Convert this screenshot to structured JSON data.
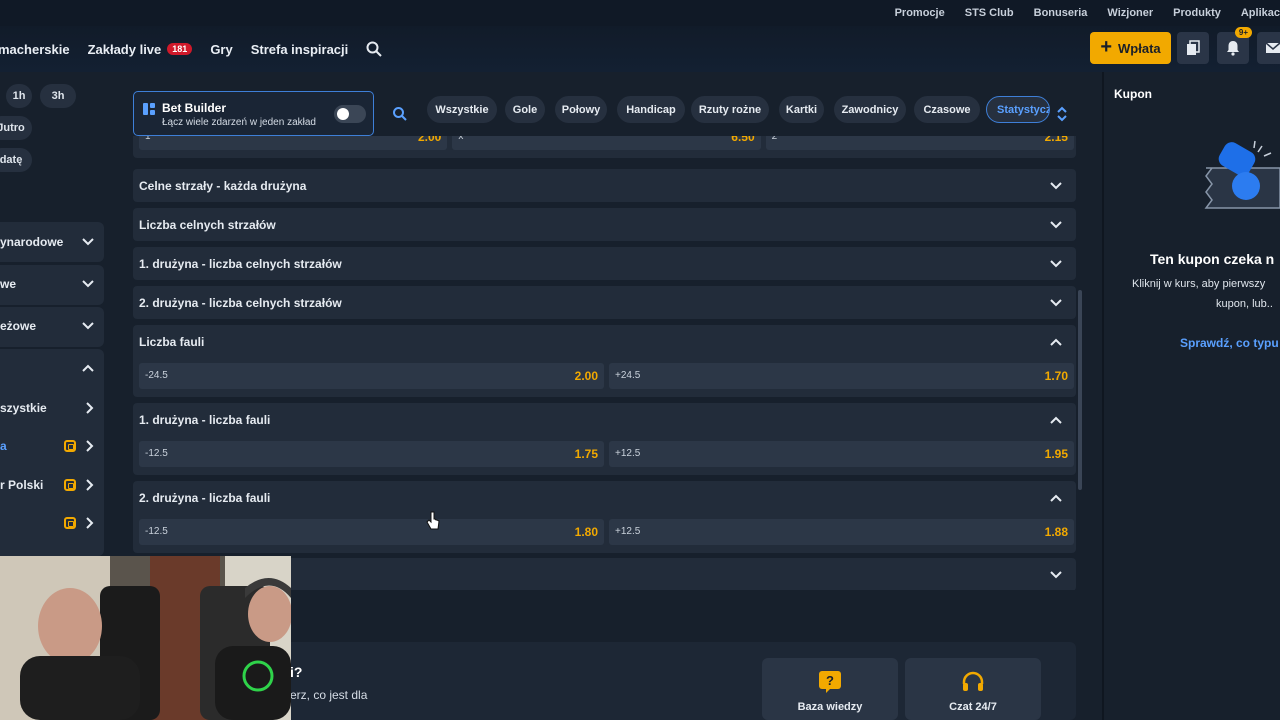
{
  "top_links": [
    "Promocje",
    "STS Club",
    "Bonuseria",
    "Wizjoner",
    "Produkty",
    "Aplikac"
  ],
  "nav": {
    "items": [
      {
        "label": "macherskie"
      },
      {
        "label": "Zakłady live",
        "badge": "181"
      },
      {
        "label": "Gry"
      },
      {
        "label": "Strefa inspiracji"
      }
    ],
    "deposit_label": "Wpłata",
    "notif_badge": "9+"
  },
  "sidebar": {
    "time_chips": [
      "1h",
      "3h"
    ],
    "day_chips": [
      "Jutro",
      "datę"
    ],
    "categories": [
      {
        "label": "ynarodowe",
        "chevron": "down"
      },
      {
        "label": "we",
        "chevron": "down"
      },
      {
        "label": "eżowe",
        "chevron": "down"
      },
      {
        "label": "",
        "chevron": "up"
      },
      {
        "label": "szystkie",
        "chevron": "right"
      },
      {
        "label": "a",
        "chevron": "right",
        "icon": true,
        "active": true
      },
      {
        "label": "r Polski",
        "chevron": "right",
        "icon": true
      },
      {
        "label": "",
        "chevron": "right",
        "icon": true
      }
    ]
  },
  "bet_builder": {
    "title": "Bet Builder",
    "subtitle": "Łącz wiele zdarzeń w jeden zakład"
  },
  "filters": [
    {
      "label": "Wszystkie"
    },
    {
      "label": "Gole"
    },
    {
      "label": "Połowy"
    },
    {
      "label": "Handicap"
    },
    {
      "label": "Rzuty rożne"
    },
    {
      "label": "Kartki"
    },
    {
      "label": "Zawodnicy"
    },
    {
      "label": "Czasowe"
    },
    {
      "label": "Statystyczne",
      "active": true
    }
  ],
  "markets": [
    {
      "title": "",
      "expanded": true,
      "odds": [
        {
          "label": "1",
          "value": "2.00"
        },
        {
          "label": "x",
          "value": "6.50"
        },
        {
          "label": "2",
          "value": "2.15"
        }
      ]
    },
    {
      "title": "Celne strzały - każda drużyna",
      "expanded": false
    },
    {
      "title": "Liczba celnych strzałów",
      "expanded": false
    },
    {
      "title": "1. drużyna - liczba celnych strzałów",
      "expanded": false
    },
    {
      "title": "2. drużyna - liczba celnych strzałów",
      "expanded": false
    },
    {
      "title": "Liczba fauli",
      "expanded": true,
      "odds": [
        {
          "label": "-24.5",
          "value": "2.00"
        },
        {
          "label": "+24.5",
          "value": "1.70"
        }
      ]
    },
    {
      "title": "1. drużyna - liczba fauli",
      "expanded": true,
      "odds": [
        {
          "label": "-12.5",
          "value": "1.75"
        },
        {
          "label": "+12.5",
          "value": "1.95"
        }
      ]
    },
    {
      "title": "2. drużyna - liczba fauli",
      "expanded": true,
      "odds": [
        {
          "label": "-12.5",
          "value": "1.80"
        },
        {
          "label": "+12.5",
          "value": "1.88"
        }
      ]
    },
    {
      "title": "",
      "expanded": false
    }
  ],
  "help": {
    "question": "i?",
    "subtitle": "erz, co jest dla",
    "cards": [
      {
        "label": "Baza wiedzy",
        "icon": "?"
      },
      {
        "label": "Czat 24/7",
        "icon": "headset"
      }
    ]
  },
  "coupon": {
    "header": "Kupon",
    "empty_title": "Ten kupon czeka n",
    "empty_text_1": "Kliknij w kurs, aby pierwszy",
    "empty_text_2": "kupon, lub..",
    "link": "Sprawdź, co typu"
  },
  "colors": {
    "accent": "#f2a900",
    "link": "#5aa0ff",
    "badge": "#d0192a"
  }
}
